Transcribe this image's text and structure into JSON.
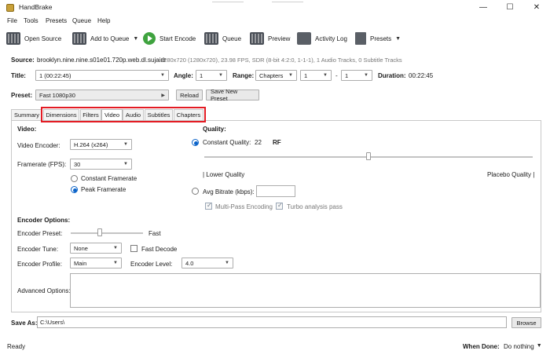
{
  "window": {
    "title": "HandBrake",
    "minimize": "—",
    "maximize": "☐",
    "close": "✕"
  },
  "menu": [
    "File",
    "Tools",
    "Presets",
    "Queue",
    "Help"
  ],
  "toolbar": {
    "open_source": "Open Source",
    "add_to_queue": "Add to Queue",
    "start_encode": "Start Encode",
    "queue": "Queue",
    "preview": "Preview",
    "activity_log": "Activity Log",
    "presets": "Presets"
  },
  "source": {
    "label": "Source:",
    "name": "brooklyn.nine.nine.s01e01.720p.web.dl.sujaidr",
    "details": "1280x720 (1280x720), 23.98 FPS, SDR (8-bit 4:2:0, 1-1-1), 1 Audio Tracks, 0 Subtitle Tracks"
  },
  "title_row": {
    "title_label": "Title:",
    "title_value": "1 (00:22:45)",
    "angle_label": "Angle:",
    "angle_value": "1",
    "range_label": "Range:",
    "range_mode": "Chapters",
    "range_start": "1",
    "range_sep": "-",
    "range_end": "1",
    "duration_label": "Duration:",
    "duration_value": "00:22:45"
  },
  "preset_row": {
    "label": "Preset:",
    "value": "Fast 1080p30",
    "reload": "Reload",
    "save_new": "Save New Preset"
  },
  "tabs": [
    "Summary",
    "Dimensions",
    "Filters",
    "Video",
    "Audio",
    "Subtitles",
    "Chapters"
  ],
  "active_tab": "Video",
  "video": {
    "section": "Video:",
    "encoder_label": "Video Encoder:",
    "encoder_value": "H.264 (x264)",
    "framerate_label": "Framerate (FPS):",
    "framerate_value": "30",
    "constant_framerate": "Constant Framerate",
    "peak_framerate": "Peak Framerate"
  },
  "quality": {
    "section": "Quality:",
    "constant_quality": "Constant Quality:",
    "cq_value": "22",
    "cq_unit": "RF",
    "slider_level": 0.5,
    "lower": "| Lower Quality",
    "placebo": "Placebo Quality |",
    "avg_bitrate": "Avg Bitrate (kbps):",
    "avg_bitrate_value": "",
    "multi_pass": "Multi-Pass Encoding",
    "turbo": "Turbo analysis pass"
  },
  "encoder_options": {
    "section": "Encoder Options:",
    "preset_label": "Encoder Preset:",
    "preset_value": "Fast",
    "preset_level": 0.4,
    "tune_label": "Encoder Tune:",
    "tune_value": "None",
    "fast_decode": "Fast Decode",
    "profile_label": "Encoder Profile:",
    "profile_value": "Main",
    "level_label": "Encoder Level:",
    "level_value": "4.0",
    "advanced_label": "Advanced Options:",
    "advanced_value": ""
  },
  "save_as": {
    "label": "Save As:",
    "value": "C:\\Users\\",
    "browse": "Browse"
  },
  "status": {
    "text": "Ready",
    "when_done_label": "When Done:",
    "when_done_value": "Do nothing"
  },
  "colors": {
    "accent": "#0a63c9",
    "highlight": "#e31b23",
    "play": "#3fa33f"
  }
}
